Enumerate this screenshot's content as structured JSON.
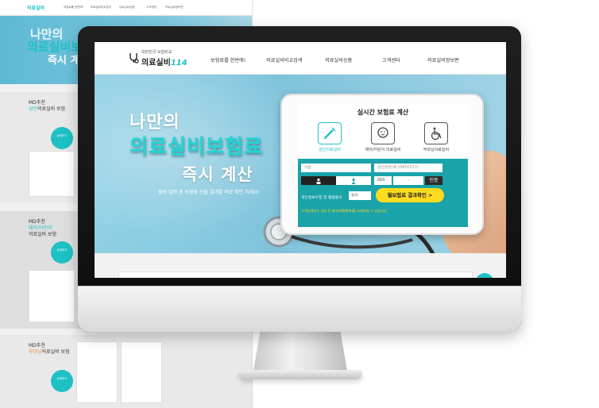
{
  "site": {
    "logo_small": "대한민국 보험비교",
    "logo_text": "의료실비",
    "logo_num": "114",
    "nav": [
      "보험료를 한번에!",
      "의료실비비교검색",
      "의료실비상품",
      "고객센터",
      "의료실비정보편"
    ]
  },
  "hero": {
    "line1": "나만의",
    "line2": "의료실비보험료",
    "line3": "즉시 계산",
    "desc": "정보 입력 후 보험료 산출 결과를 바로 확인 하세요!"
  },
  "calculator": {
    "title": "실시간 보험료 계산",
    "options": [
      {
        "label": "성인의료실비",
        "icon": "syringe-icon",
        "active": true
      },
      {
        "label": "태아/어린이 의료실비",
        "icon": "baby-icon",
        "active": false
      },
      {
        "label": "부모님의료실비",
        "icon": "wheelchair-icon",
        "active": false
      }
    ],
    "name_placeholder": "이름",
    "birth_placeholder": "생년월일(예:19850513)",
    "phone_prefix": "010",
    "phone_sep": "-",
    "auth_label": "인증",
    "consent_text": "개인정보수집 및 활용동의",
    "agree_label": "동의",
    "result_button": "월보험료 결과확인 >",
    "privacy_text": "고객님께서는 상담 후 해지(회원탈퇴)를 요청하실 수 있습니다."
  },
  "background_page": {
    "logo": "의료실비",
    "nav": [
      "보험료를 한번에!",
      "의료실비비교검색",
      "의료실비상품",
      "고객센터",
      "의료실비정보편"
    ],
    "hero_l1": "나만의",
    "hero_l2": "의료실비보험",
    "hero_l3": "즉시 계",
    "sections": [
      {
        "pick": "MD추천",
        "title_hl": "성인",
        "title": "의료실비 보험",
        "button": "상세보기"
      },
      {
        "pick": "MD추천",
        "title_hl": "태아/어린이",
        "title": "의료실비 보험",
        "button": "상세보기"
      },
      {
        "pick": "MD추천",
        "title_hl": "부모님",
        "title": "의료실비 보험",
        "button": "상세보기"
      }
    ]
  },
  "colors": {
    "accent": "#1ec1c4",
    "form_bg": "#1aa3a8",
    "button": "#ffdc1f"
  }
}
